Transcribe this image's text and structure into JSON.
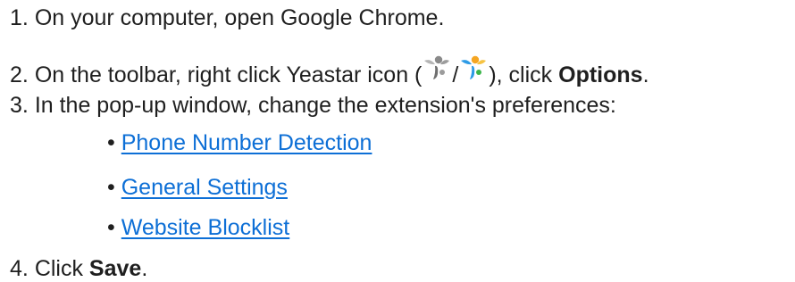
{
  "steps": [
    {
      "number": "1.",
      "text": "On your computer, open Google Chrome."
    },
    {
      "number": "2.",
      "text_before": "On the toolbar, right click Yeastar icon (",
      "separator": "/",
      "text_mid": "), click ",
      "bold": "Options",
      "text_after": "."
    },
    {
      "number": "3.",
      "text": "In the pop-up window, change the extension's preferences:"
    },
    {
      "number": "4.",
      "text_before": "Click ",
      "bold": "Save",
      "text_after": "."
    }
  ],
  "bullets": [
    {
      "bullet": "•",
      "label": "Phone Number Detection"
    },
    {
      "bullet": "•",
      "label": "General Settings"
    },
    {
      "bullet": "•",
      "label": "Website Blocklist"
    }
  ],
  "icons": {
    "gray": {
      "name": "yeastar-icon-gray",
      "colors": [
        "#8a8a8a",
        "#b5b5b5",
        "#6f6f6f",
        "#9c9c9c"
      ]
    },
    "color": {
      "name": "yeastar-icon-color",
      "colors": [
        "#f5a623",
        "#2e9be6",
        "#3bb54a",
        "#f6c343"
      ]
    }
  },
  "colors": {
    "text": "#1f1f1f",
    "link": "#0d6fd6"
  }
}
